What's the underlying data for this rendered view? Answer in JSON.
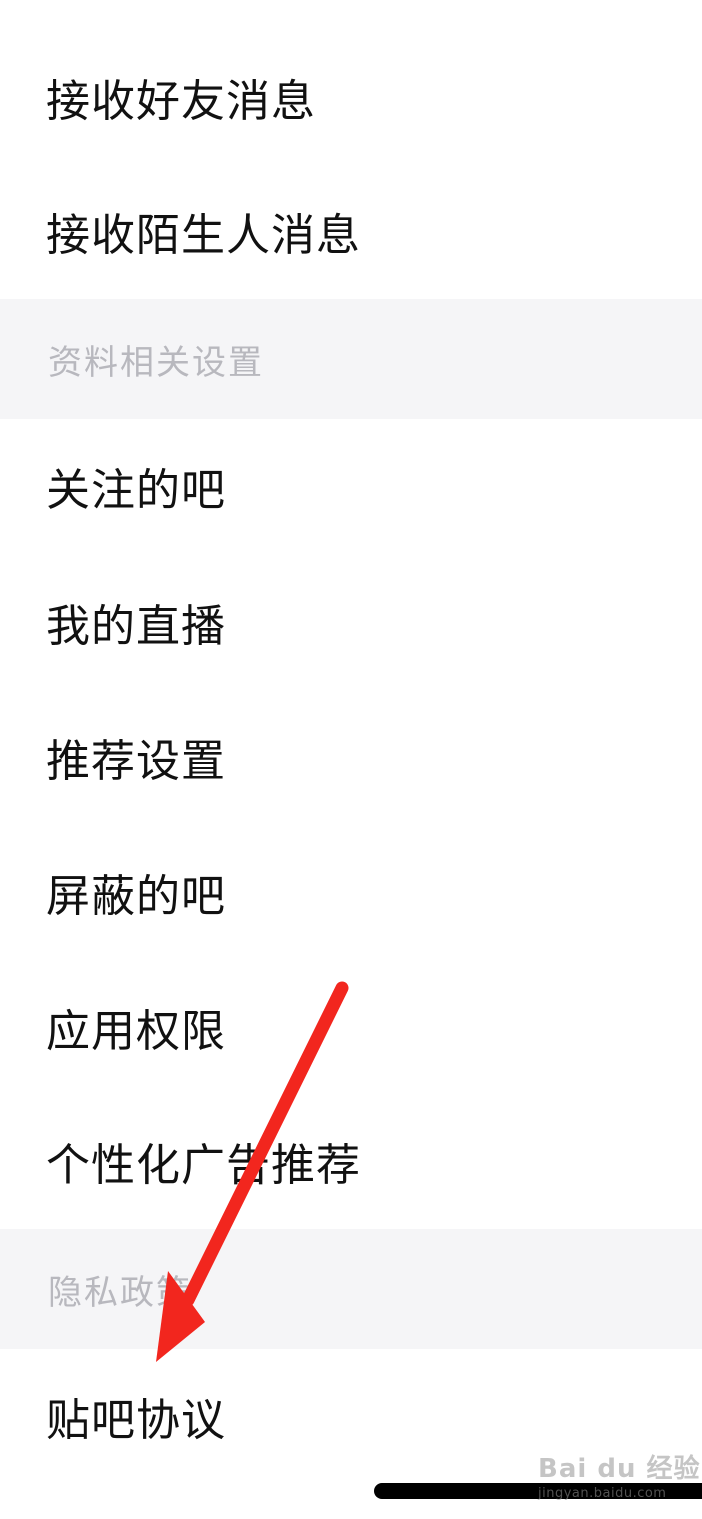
{
  "rows_top": [
    {
      "label": "接收好友消息"
    },
    {
      "label": "接收陌生人消息"
    }
  ],
  "section_profile": {
    "label": "资料相关设置"
  },
  "rows_profile": [
    {
      "label": "关注的吧"
    },
    {
      "label": "我的直播"
    },
    {
      "label": "推荐设置"
    },
    {
      "label": "屏蔽的吧"
    },
    {
      "label": "应用权限"
    },
    {
      "label": "个性化广告推荐"
    }
  ],
  "section_privacy": {
    "label": "隐私政策"
  },
  "rows_privacy": [
    {
      "label": "贴吧协议"
    }
  ],
  "annotation": {
    "arrow_color": "#f2261e",
    "arrow_icon": "red-arrow-pointer"
  },
  "watermark": {
    "text": "Bai du 经验",
    "url": "jingyan.baidu.com"
  }
}
